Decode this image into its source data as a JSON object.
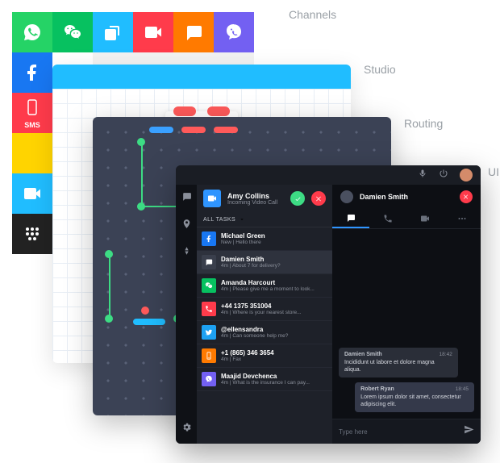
{
  "labels": {
    "channels": "Channels",
    "studio": "Studio",
    "routing": "Routing",
    "ui": "UI"
  },
  "channels": {
    "tiles": [
      {
        "name": "whatsapp",
        "bg": "#25D366"
      },
      {
        "name": "wechat",
        "bg": "#07C160"
      },
      {
        "name": "copy",
        "bg": "#20bdff"
      },
      {
        "name": "video",
        "bg": "#ff3b4b"
      },
      {
        "name": "chat",
        "bg": "#ff7a00"
      },
      {
        "name": "viber",
        "bg": "#7360f2"
      },
      {
        "name": "facebook",
        "bg": "#1877f2"
      },
      {
        "name": "ring",
        "bg": "#ffffff"
      },
      {
        "name": "",
        "bg": "#f2f2f2"
      },
      {
        "name": "",
        "bg": "#f2f2f2"
      },
      {
        "name": "",
        "bg": "#f2f2f2"
      },
      {
        "name": "",
        "bg": "#f2f2f2"
      },
      {
        "name": "sms",
        "bg": "#ff3b4b",
        "label": "SMS"
      },
      {
        "name": "",
        "bg": "#f2f2f2"
      },
      {
        "name": "",
        "bg": "#f2f2f2"
      },
      {
        "name": "",
        "bg": "#f2f2f2"
      },
      {
        "name": "",
        "bg": "#f2f2f2"
      },
      {
        "name": "",
        "bg": "#f2f2f2"
      },
      {
        "name": "",
        "bg": "#ffd400"
      },
      {
        "name": "",
        "bg": "#0b8a3e"
      },
      {
        "name": "",
        "bg": "#f2f2f2"
      },
      {
        "name": "",
        "bg": "#f2f2f2"
      },
      {
        "name": "",
        "bg": "#f2f2f2"
      },
      {
        "name": "",
        "bg": "#f2f2f2"
      },
      {
        "name": "video",
        "bg": "#20bdff"
      },
      {
        "name": "",
        "bg": "#1b2a4e"
      },
      {
        "name": "",
        "bg": "#f2f2f2"
      },
      {
        "name": "",
        "bg": "#f2f2f2"
      },
      {
        "name": "",
        "bg": "#f2f2f2"
      },
      {
        "name": "",
        "bg": "#f2f2f2"
      },
      {
        "name": "bbm",
        "bg": "#222"
      },
      {
        "name": "twitter",
        "bg": "#1da1f2"
      },
      {
        "name": "",
        "bg": "#f2f2f2"
      },
      {
        "name": "",
        "bg": "#f2f2f2"
      },
      {
        "name": "",
        "bg": "#f2f2f2"
      },
      {
        "name": "",
        "bg": "#f2f2f2"
      }
    ]
  },
  "ui_panel": {
    "incoming": {
      "name": "Amy Collins",
      "sub": "Incoming Video Call"
    },
    "all_tasks_label": "ALL TASKS",
    "tasks": [
      {
        "icon": "facebook",
        "bg": "#1877f2",
        "name": "Michael Green",
        "sub": "New | Hello there"
      },
      {
        "icon": "chat",
        "bg": "#3a3f4c",
        "name": "Damien Smith",
        "sub": "4m | About 7 for delivery?",
        "selected": true
      },
      {
        "icon": "wechat",
        "bg": "#07C160",
        "name": "Amanda Harcourt",
        "sub": "4m | Please give me a moment to look..."
      },
      {
        "icon": "phone",
        "bg": "#ff3b4b",
        "name": "+44 1375 351004",
        "sub": "4m | Where is your nearest store..."
      },
      {
        "icon": "twitter",
        "bg": "#1da1f2",
        "name": "@ellensandra",
        "sub": "4m | Can someone help me?"
      },
      {
        "icon": "sms",
        "bg": "#ff7a00",
        "name": "+1 (865) 346 3654",
        "sub": "4m | Fax"
      },
      {
        "icon": "viber",
        "bg": "#7360f2",
        "name": "Maajid Devchenca",
        "sub": "4m | What is the insurance I can pay..."
      }
    ],
    "chat": {
      "title": "Damien Smith",
      "messages": [
        {
          "name": "Damien Smith",
          "time": "18:42",
          "text": "Incididunt ut labore et dolore magna aliqua.",
          "side": "left"
        },
        {
          "name": "Robert Ryan",
          "time": "18:45",
          "text": "Lorem ipsum dolor sit amet, consectetur adipiscing elit.",
          "side": "right"
        }
      ],
      "placeholder": "Type here"
    }
  }
}
